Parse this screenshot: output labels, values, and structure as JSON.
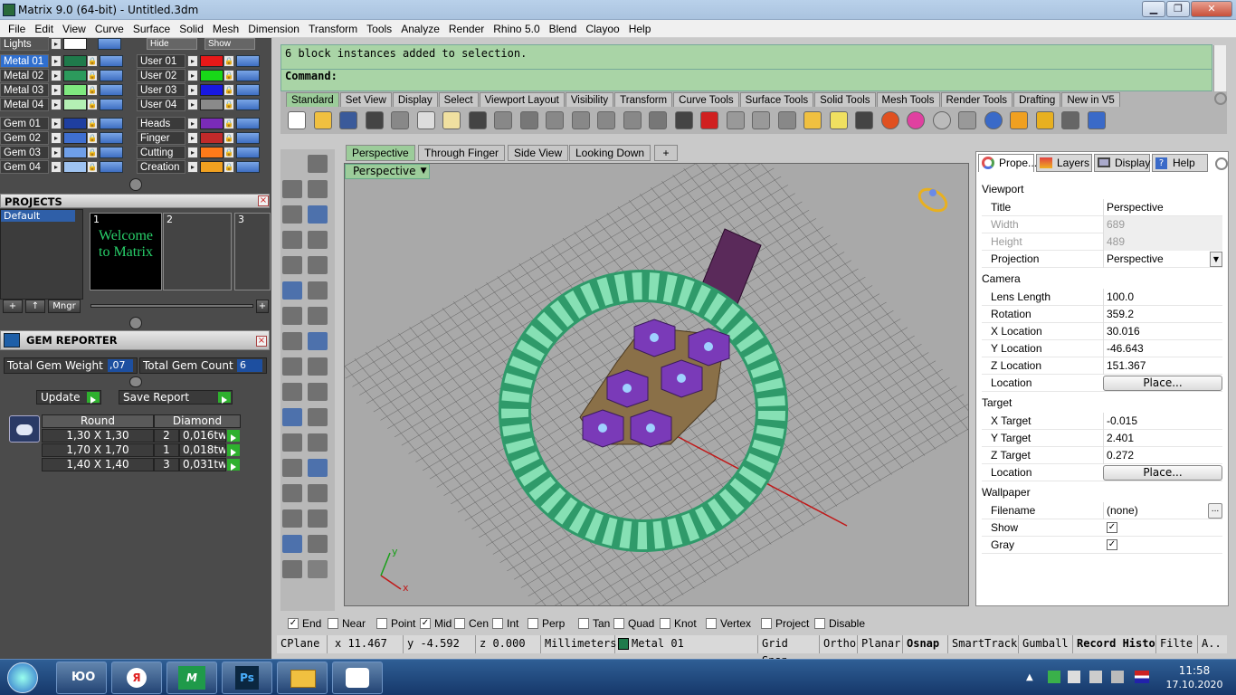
{
  "window": {
    "title": "Matrix 9.0 (64-bit) - Untitled.3dm",
    "min": "▁",
    "max": "❐",
    "close": "✕"
  },
  "menu": [
    "File",
    "Edit",
    "View",
    "Curve",
    "Surface",
    "Solid",
    "Mesh",
    "Dimension",
    "Transform",
    "Tools",
    "Analyze",
    "Render",
    "Rhino 5.0",
    "Blend",
    "Clayoo",
    "Help"
  ],
  "layers": {
    "header": {
      "lights": "Lights",
      "hide": "Hide",
      "show": "Show"
    },
    "left": [
      {
        "name": "Metal 01",
        "color": "#1f7a4b",
        "selected": true
      },
      {
        "name": "Metal 02",
        "color": "#2c9a5c"
      },
      {
        "name": "Metal 03",
        "color": "#7fe87f"
      },
      {
        "name": "Metal 04",
        "color": "#b4f0b4"
      },
      {
        "name": "Gem 01",
        "color": "#1f3fa0"
      },
      {
        "name": "Gem 02",
        "color": "#3f6fd0"
      },
      {
        "name": "Gem 03",
        "color": "#6f9fe8"
      },
      {
        "name": "Gem 04",
        "color": "#9fc3f0"
      }
    ],
    "right": [
      {
        "name": "User 01",
        "color": "#e81818"
      },
      {
        "name": "User 02",
        "color": "#18d818"
      },
      {
        "name": "User 03",
        "color": "#1818e0"
      },
      {
        "name": "User 04",
        "color": "#8a8a8a"
      },
      {
        "name": "Heads",
        "color": "#7a2bb8"
      },
      {
        "name": "Finger",
        "color": "#c02a2a"
      },
      {
        "name": "Cutting",
        "color": "#ff7a1a"
      },
      {
        "name": "Creation",
        "color": "#f0a020"
      }
    ]
  },
  "projects": {
    "title": "PROJECTS",
    "default": "Default",
    "slots": [
      "1",
      "2",
      "3"
    ],
    "welcome": "Welcome to Matrix",
    "mngr": "Mngr"
  },
  "gem_reporter": {
    "title": "GEM REPORTER",
    "weight_label": "Total Gem Weight",
    "weight_value": ",07",
    "count_label": "Total Gem Count",
    "count_value": "6",
    "update": "Update",
    "save": "Save Report",
    "col_shape": "Round",
    "col_type": "Diamond",
    "rows": [
      {
        "size": "1,30 X 1,30",
        "count": "2",
        "weight": "0,016tw"
      },
      {
        "size": "1,70 X 1,70",
        "count": "1",
        "weight": "0,018tw"
      },
      {
        "size": "1,40 X 1,40",
        "count": "3",
        "weight": "0,031tw"
      }
    ]
  },
  "command": {
    "history": "6 block instances added to selection.",
    "prompt": "Command:"
  },
  "toolbar_tabs": [
    "Standard",
    "Set View",
    "Display",
    "Select",
    "Viewport Layout",
    "Visibility",
    "Transform",
    "Curve Tools",
    "Surface Tools",
    "Solid Tools",
    "Mesh Tools",
    "Render Tools",
    "Drafting",
    "New in V5"
  ],
  "viewport_tabs": [
    "Perspective",
    "Through Finger",
    "Side View",
    "Looking Down"
  ],
  "viewport_label": "Perspective",
  "props": {
    "tabs": [
      "Prope...",
      "Layers",
      "Display",
      "Help"
    ],
    "viewport_group": "Viewport",
    "title_k": "Title",
    "title_v": "Perspective",
    "width_k": "Width",
    "width_v": "689",
    "height_k": "Height",
    "height_v": "489",
    "projection_k": "Projection",
    "projection_v": "Perspective",
    "camera_group": "Camera",
    "lens_k": "Lens Length",
    "lens_v": "100.0",
    "rot_k": "Rotation",
    "rot_v": "359.2",
    "xloc_k": "X Location",
    "xloc_v": "30.016",
    "yloc_k": "Y Location",
    "yloc_v": "-46.643",
    "zloc_k": "Z Location",
    "zloc_v": "151.367",
    "loc_k": "Location",
    "place": "Place...",
    "target_group": "Target",
    "xt_k": "X Target",
    "xt_v": "-0.015",
    "yt_k": "Y Target",
    "yt_v": "2.401",
    "zt_k": "Z Target",
    "zt_v": "0.272",
    "wall_group": "Wallpaper",
    "file_k": "Filename",
    "file_v": "(none)",
    "show_k": "Show",
    "gray_k": "Gray"
  },
  "osnap": [
    {
      "label": "End",
      "checked": true
    },
    {
      "label": "Near",
      "checked": false
    },
    {
      "label": "Point",
      "checked": false
    },
    {
      "label": "Mid",
      "checked": true
    },
    {
      "label": "Cen",
      "checked": false
    },
    {
      "label": "Int",
      "checked": false
    },
    {
      "label": "Perp",
      "checked": false
    },
    {
      "label": "Tan",
      "checked": false
    },
    {
      "label": "Quad",
      "checked": false
    },
    {
      "label": "Knot",
      "checked": false
    },
    {
      "label": "Vertex",
      "checked": false
    },
    {
      "label": "Project",
      "checked": false
    },
    {
      "label": "Disable",
      "checked": false
    }
  ],
  "status": {
    "cplane": "CPlane",
    "x": "x 11.467",
    "y": "y -4.592",
    "z": "z 0.000",
    "units": "Millimeters",
    "layer": "Metal 01",
    "grid": "Grid Snap",
    "ortho": "Ortho",
    "planar": "Planar",
    "osnap": "Osnap",
    "smarttrack": "SmartTrack",
    "gumball": "Gumball",
    "record": "Record Histo",
    "filter": "Filte",
    "a": "A.."
  },
  "taskbar": {
    "time": "11:58",
    "date": "17.10.2020",
    "lang": "ЮО"
  }
}
